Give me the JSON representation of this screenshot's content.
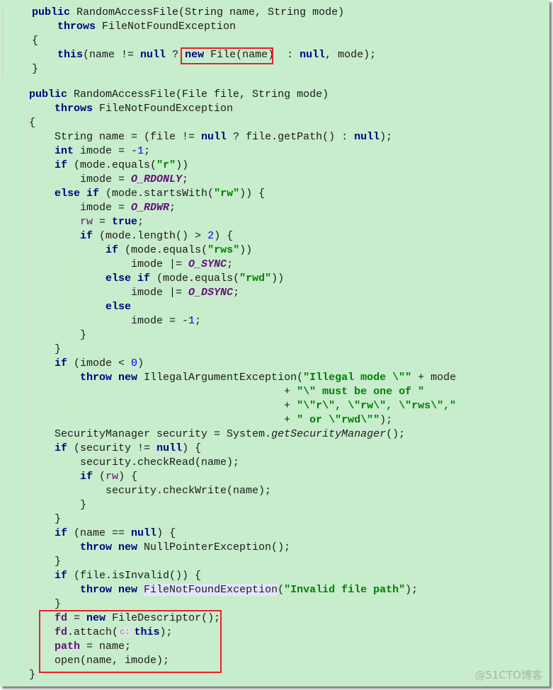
{
  "editor": {
    "background": "#c7edcc",
    "highlight_box_color": "#e8202a",
    "watermark": "@51CTO博客",
    "inlay_hint": "c:",
    "block1": [
      [
        [
          "kw",
          "public"
        ],
        [
          "t",
          " RandomAccessFile(String name, String mode)"
        ]
      ],
      [
        [
          "t",
          "    "
        ],
        [
          "kw",
          "throws"
        ],
        [
          "t",
          " FileNotFoundException"
        ]
      ],
      [
        [
          "t",
          "{"
        ]
      ],
      [
        [
          "t",
          "    "
        ],
        [
          "kw",
          "this"
        ],
        [
          "t",
          "(name != "
        ],
        [
          "kw",
          "null"
        ],
        [
          "t",
          " ? "
        ],
        [
          "kw",
          "new"
        ],
        [
          "t",
          " File(name)  : "
        ],
        [
          "kw",
          "null"
        ],
        [
          "t",
          ", mode);"
        ]
      ],
      [
        [
          "t",
          "}"
        ]
      ]
    ],
    "block2": [
      [
        [
          "kw",
          "public"
        ],
        [
          "t",
          " RandomAccessFile(File file, String mode)"
        ]
      ],
      [
        [
          "t",
          "    "
        ],
        [
          "kw",
          "throws"
        ],
        [
          "t",
          " FileNotFoundException"
        ]
      ],
      [
        [
          "t",
          "{"
        ]
      ],
      [
        [
          "t",
          "    String name = (file != "
        ],
        [
          "kw",
          "null"
        ],
        [
          "t",
          " ? file.getPath() : "
        ],
        [
          "kw",
          "null"
        ],
        [
          "t",
          ");"
        ]
      ],
      [
        [
          "t",
          "    "
        ],
        [
          "kw",
          "int"
        ],
        [
          "t",
          " imode = -"
        ],
        [
          "num",
          "1"
        ],
        [
          "t",
          ";"
        ]
      ],
      [
        [
          "t",
          "    "
        ],
        [
          "kw",
          "if"
        ],
        [
          "t",
          " (mode.equals("
        ],
        [
          "str",
          "\"r\""
        ],
        [
          "t",
          "))"
        ]
      ],
      [
        [
          "t",
          "        imode = "
        ],
        [
          "const",
          "O_RDONLY"
        ],
        [
          "t",
          ";"
        ]
      ],
      [
        [
          "t",
          "    "
        ],
        [
          "kw",
          "else if"
        ],
        [
          "t",
          " (mode.startsWith("
        ],
        [
          "str",
          "\"rw\""
        ],
        [
          "t",
          ")) {"
        ]
      ],
      [
        [
          "t",
          "        imode = "
        ],
        [
          "const",
          "O_RDWR"
        ],
        [
          "t",
          ";"
        ]
      ],
      [
        [
          "t",
          "        "
        ],
        [
          "field",
          "rw"
        ],
        [
          "t",
          " = "
        ],
        [
          "kw",
          "true"
        ],
        [
          "t",
          ";"
        ]
      ],
      [
        [
          "t",
          "        "
        ],
        [
          "kw",
          "if"
        ],
        [
          "t",
          " (mode.length() > "
        ],
        [
          "num",
          "2"
        ],
        [
          "t",
          ") {"
        ]
      ],
      [
        [
          "t",
          "            "
        ],
        [
          "kw",
          "if"
        ],
        [
          "t",
          " (mode.equals("
        ],
        [
          "str",
          "\"rws\""
        ],
        [
          "t",
          "))"
        ]
      ],
      [
        [
          "t",
          "                imode |= "
        ],
        [
          "const",
          "O_SYNC"
        ],
        [
          "t",
          ";"
        ]
      ],
      [
        [
          "t",
          "            "
        ],
        [
          "kw",
          "else if"
        ],
        [
          "t",
          " (mode.equals("
        ],
        [
          "str",
          "\"rwd\""
        ],
        [
          "t",
          "))"
        ]
      ],
      [
        [
          "t",
          "                imode |= "
        ],
        [
          "const",
          "O_DSYNC"
        ],
        [
          "t",
          ";"
        ]
      ],
      [
        [
          "t",
          "            "
        ],
        [
          "kw",
          "else"
        ]
      ],
      [
        [
          "t",
          "                imode = -"
        ],
        [
          "num",
          "1"
        ],
        [
          "t",
          ";"
        ]
      ],
      [
        [
          "t",
          "        }"
        ]
      ],
      [
        [
          "t",
          "    }"
        ]
      ],
      [
        [
          "t",
          "    "
        ],
        [
          "kw",
          "if"
        ],
        [
          "t",
          " (imode < "
        ],
        [
          "num",
          "0"
        ],
        [
          "t",
          ")"
        ]
      ],
      [
        [
          "t",
          "        "
        ],
        [
          "kw",
          "throw new"
        ],
        [
          "t",
          " IllegalArgumentException("
        ],
        [
          "str",
          "\"Illegal mode \\\"\""
        ],
        [
          "t",
          " + mode"
        ]
      ],
      [
        [
          "t",
          "                                        + "
        ],
        [
          "str",
          "\"\\\" must be one of \""
        ]
      ],
      [
        [
          "t",
          "                                        + "
        ],
        [
          "str",
          "\"\\\"r\\\", \\\"rw\\\", \\\"rws\\\",\""
        ]
      ],
      [
        [
          "t",
          "                                        + "
        ],
        [
          "str",
          "\" or \\\"rwd\\\"\""
        ],
        [
          "t",
          ");"
        ]
      ],
      [
        [
          "t",
          "    SecurityManager security = System."
        ],
        [
          "ital",
          "getSecurityManager"
        ],
        [
          "t",
          "();"
        ]
      ],
      [
        [
          "t",
          "    "
        ],
        [
          "kw",
          "if"
        ],
        [
          "t",
          " (security != "
        ],
        [
          "kw",
          "null"
        ],
        [
          "t",
          ") {"
        ]
      ],
      [
        [
          "t",
          "        security.checkRead(name);"
        ]
      ],
      [
        [
          "t",
          "        "
        ],
        [
          "kw",
          "if"
        ],
        [
          "t",
          " ("
        ],
        [
          "field",
          "rw"
        ],
        [
          "t",
          ") {"
        ]
      ],
      [
        [
          "t",
          "            security.checkWrite(name);"
        ]
      ],
      [
        [
          "t",
          "        }"
        ]
      ],
      [
        [
          "t",
          "    }"
        ]
      ],
      [
        [
          "t",
          "    "
        ],
        [
          "kw",
          "if"
        ],
        [
          "t",
          " (name == "
        ],
        [
          "kw",
          "null"
        ],
        [
          "t",
          ") {"
        ]
      ],
      [
        [
          "t",
          "        "
        ],
        [
          "kw",
          "throw new"
        ],
        [
          "t",
          " NullPointerException();"
        ]
      ],
      [
        [
          "t",
          "    }"
        ]
      ],
      [
        [
          "t",
          "    "
        ],
        [
          "kw",
          "if"
        ],
        [
          "t",
          " (file.isInvalid()) {"
        ]
      ],
      [
        [
          "t",
          "        "
        ],
        [
          "kw",
          "throw new"
        ],
        [
          "t",
          " "
        ],
        [
          "hl",
          "FileNotFoundException"
        ],
        [
          "t",
          "("
        ],
        [
          "str",
          "\"Invalid file path\""
        ],
        [
          "t",
          ");"
        ]
      ],
      [
        [
          "t",
          "    }"
        ]
      ],
      [
        [
          "t",
          "    "
        ],
        [
          "fieldb",
          "fd"
        ],
        [
          "t",
          " = "
        ],
        [
          "kw",
          "new"
        ],
        [
          "t",
          " FileDescriptor();"
        ]
      ],
      [
        [
          "t",
          "    "
        ],
        [
          "fieldb",
          "fd"
        ],
        [
          "t",
          ".attach("
        ],
        [
          "hint",
          "c:"
        ],
        [
          "kw",
          "this"
        ],
        [
          "t",
          ");"
        ]
      ],
      [
        [
          "t",
          "    "
        ],
        [
          "fieldb",
          "path"
        ],
        [
          "t",
          " = name;"
        ]
      ],
      [
        [
          "t",
          "    open(name, imode);"
        ]
      ],
      [
        [
          "t",
          "}"
        ]
      ]
    ]
  }
}
